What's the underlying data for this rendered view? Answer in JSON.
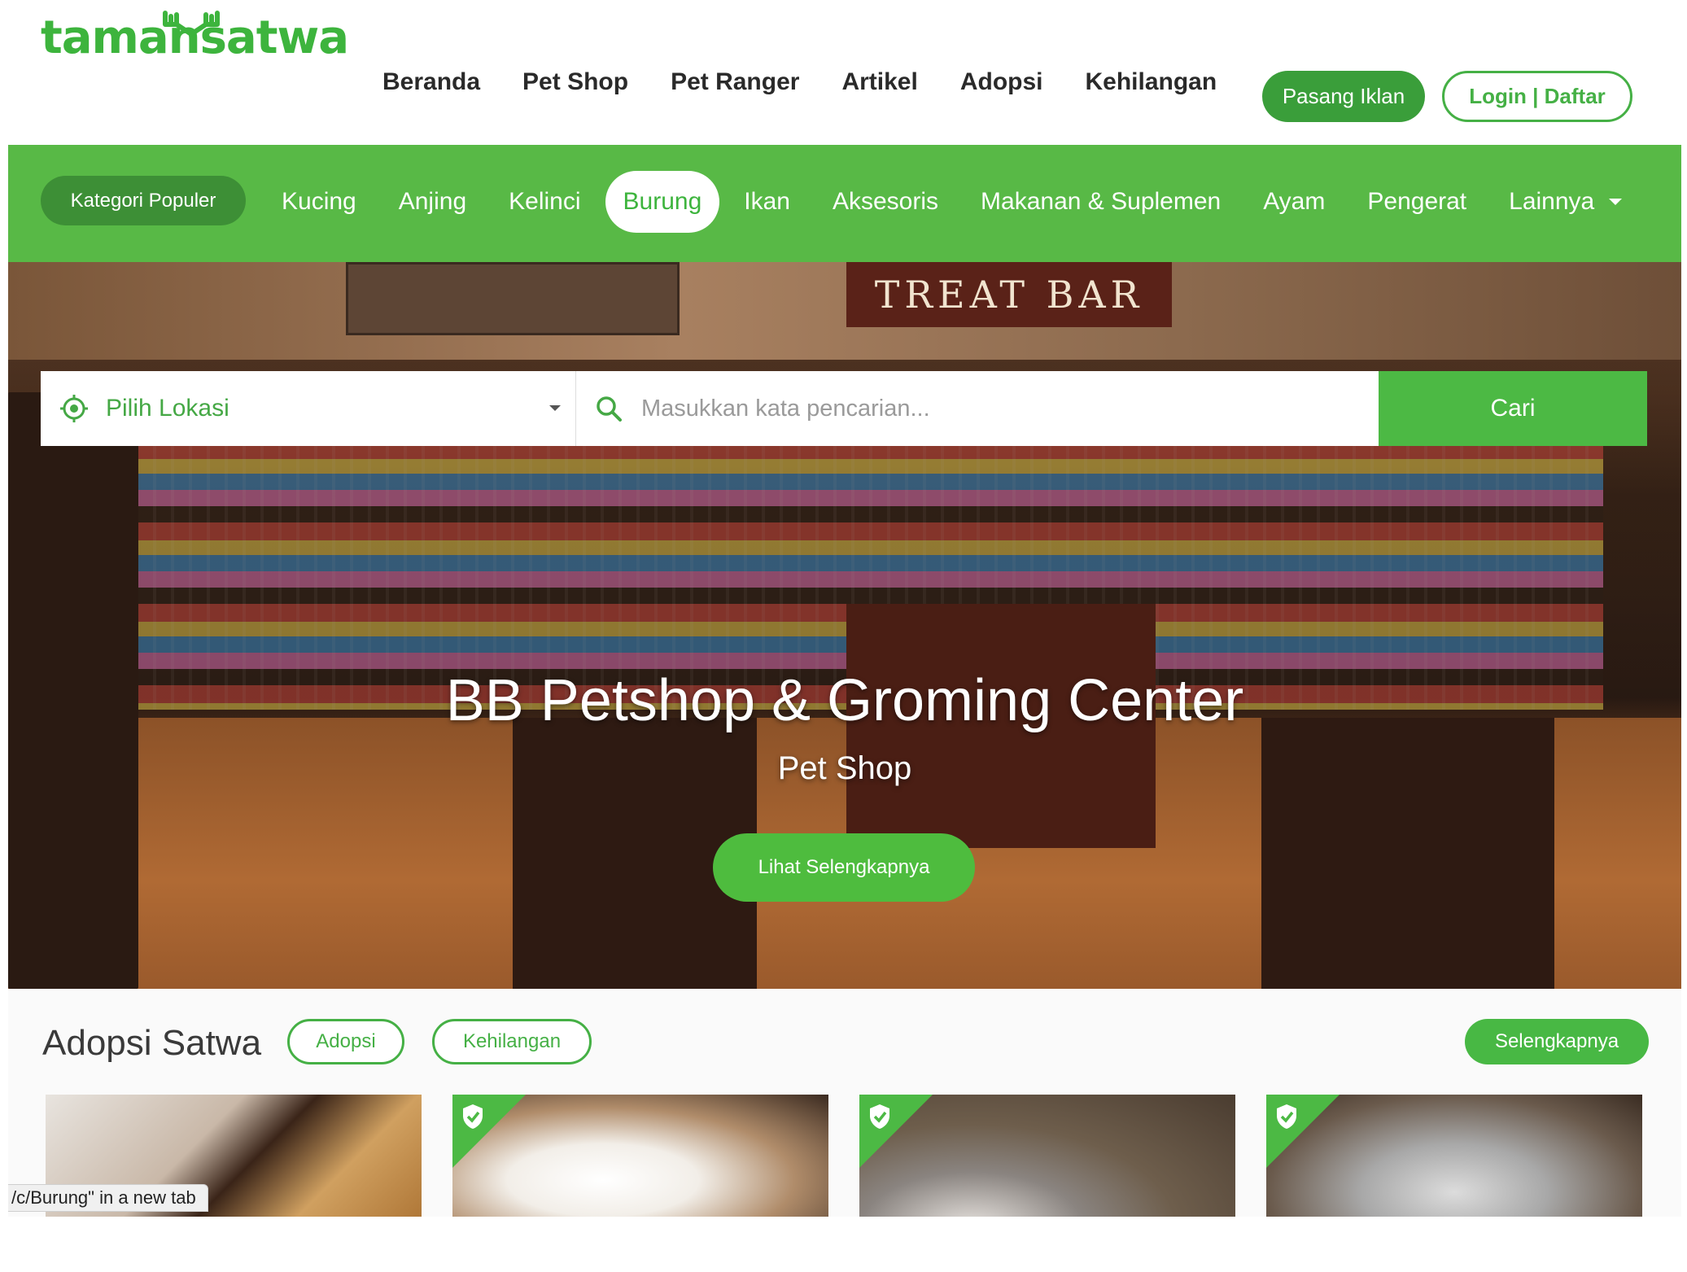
{
  "brand": {
    "logo_text": "tamansatwa",
    "accent_color": "#3db43d"
  },
  "header": {
    "nav": [
      "Beranda",
      "Pet Shop",
      "Pet Ranger",
      "Artikel",
      "Adopsi",
      "Kehilangan"
    ],
    "post_ad_label": "Pasang Iklan",
    "login_label": "Login | Daftar"
  },
  "categories": {
    "popular_label": "Kategori Populer",
    "items": [
      "Kucing",
      "Anjing",
      "Kelinci",
      "Burung",
      "Ikan",
      "Aksesoris",
      "Makanan & Suplemen",
      "Ayam",
      "Pengerat"
    ],
    "active": "Burung",
    "more_label": "Lainnya"
  },
  "search": {
    "location_label": "Pilih Lokasi",
    "query_placeholder": "Masukkan kata pencarian...",
    "submit_label": "Cari"
  },
  "hero": {
    "title": "BB Petshop & Groming Center",
    "subtitle": "Pet Shop",
    "cta_label": "Lihat Selengkapnya",
    "sign_text": "TREAT BAR"
  },
  "adopsi": {
    "title": "Adopsi Satwa",
    "filters": [
      "Adopsi",
      "Kehilangan"
    ],
    "more_label": "Selengkapnya",
    "cards": [
      {
        "verified": false,
        "photo": "orange-cat"
      },
      {
        "verified": true,
        "photo": "white-kitten"
      },
      {
        "verified": true,
        "photo": "grey-kitten"
      },
      {
        "verified": true,
        "photo": "blue-eyed-cat"
      }
    ]
  },
  "browser_status": {
    "text": "/c/Burung\" in a new tab"
  }
}
